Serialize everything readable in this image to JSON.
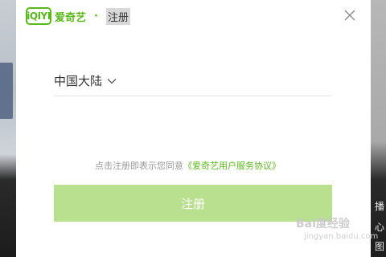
{
  "background": {
    "right_side_texts": [
      "播",
      "心",
      "图"
    ]
  },
  "dialog": {
    "logo_text": "iQIYI",
    "brand_name": "爱奇艺",
    "separator": "·",
    "title": "注册",
    "region": {
      "label": "中国大陆",
      "icon": "chevron-down-icon"
    },
    "agreement": {
      "prefix": "点击注册即表示您同意",
      "link": "《爱奇艺用户服务协议》"
    },
    "register_button_label": "注册",
    "close_icon": "close-icon"
  },
  "watermark": {
    "text": "Bai度经验",
    "sub": "jingyan.baidu.com"
  },
  "colors": {
    "brand_green": "#5bb81b",
    "button_disabled_green": "#b8e08f"
  }
}
